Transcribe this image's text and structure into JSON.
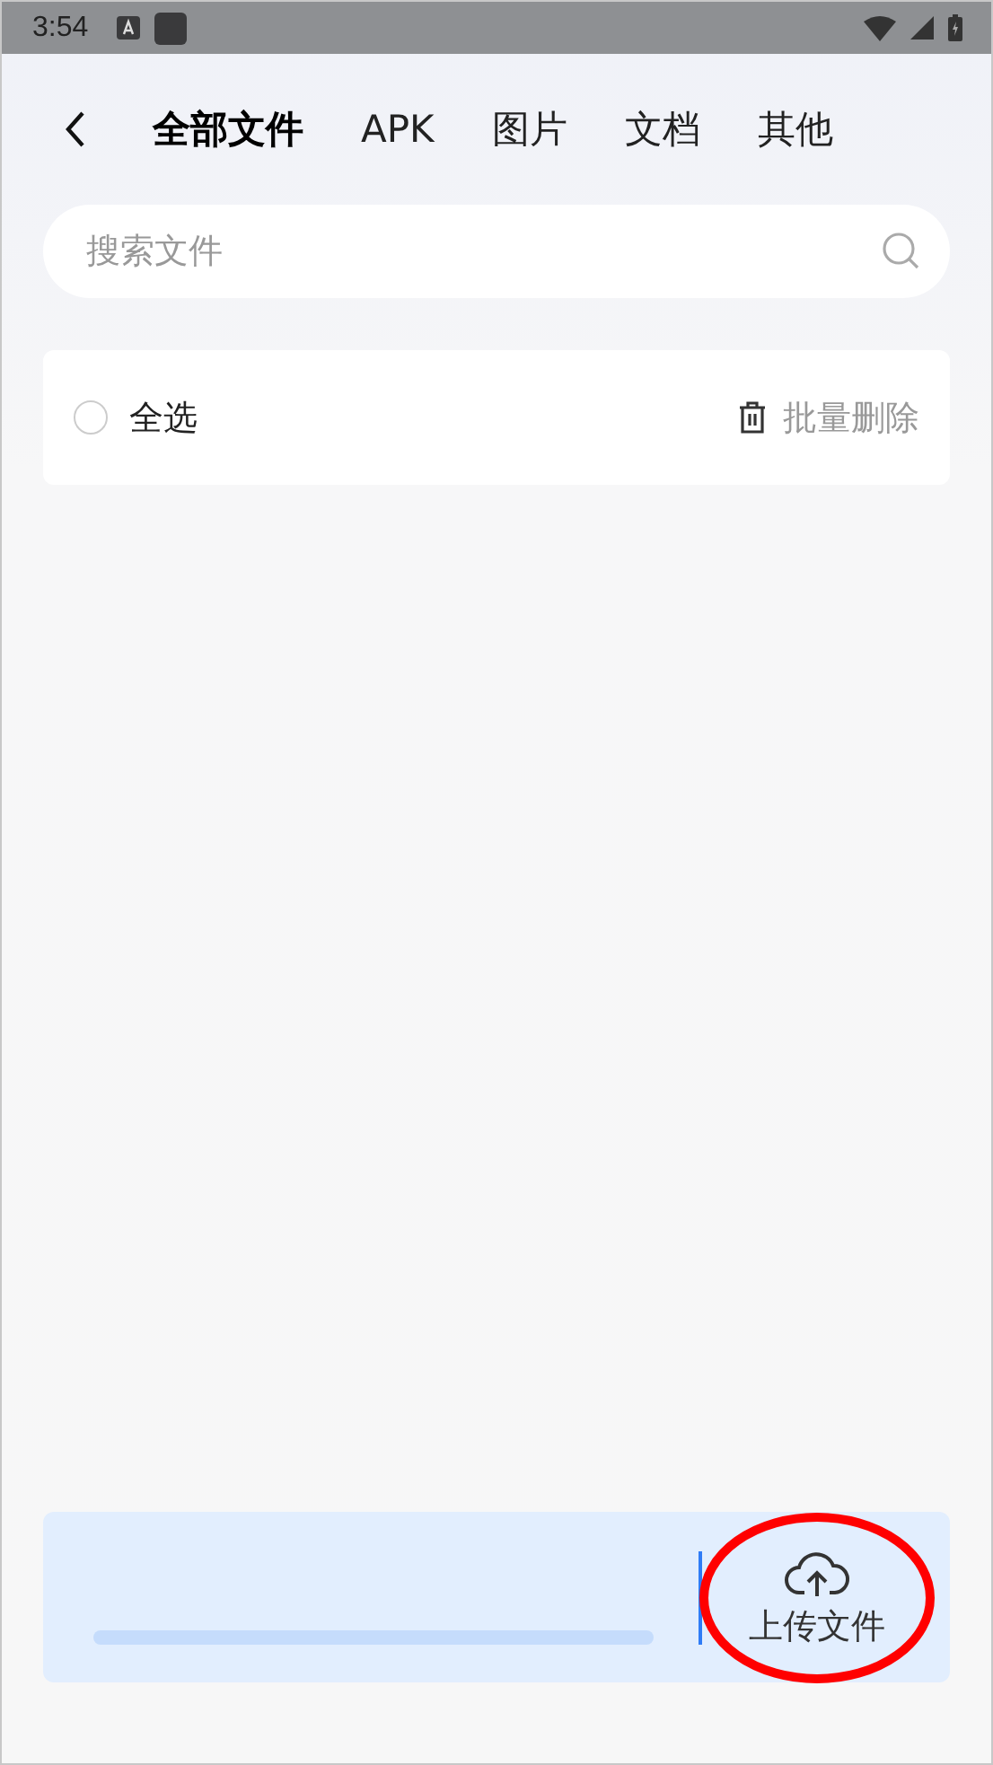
{
  "status_bar": {
    "time": "3:54"
  },
  "tabs": [
    {
      "label": "全部文件",
      "selected": true
    },
    {
      "label": "APK",
      "selected": false
    },
    {
      "label": "图片",
      "selected": false
    },
    {
      "label": "文档",
      "selected": false
    },
    {
      "label": "其他",
      "selected": false
    }
  ],
  "search": {
    "placeholder": "搜索文件"
  },
  "select_all": {
    "label": "全选",
    "checked": false
  },
  "batch_delete": {
    "label": "批量删除"
  },
  "upload_panel": {
    "button": {
      "label": "上传文件",
      "highlighted": true
    }
  }
}
